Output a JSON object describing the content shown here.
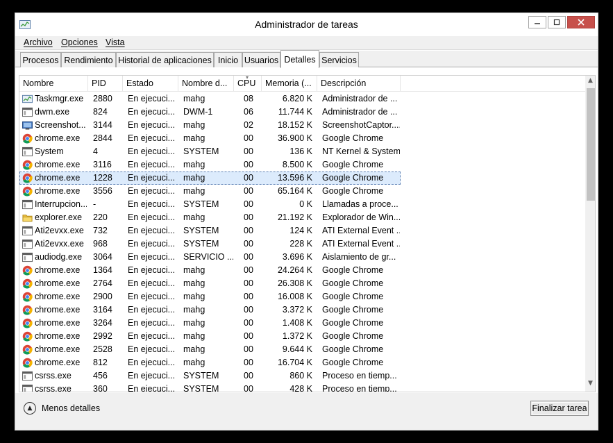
{
  "window": {
    "title": "Administrador de tareas"
  },
  "menu": [
    {
      "label": "Archivo",
      "name": "menu-archivo"
    },
    {
      "label": "Opciones",
      "name": "menu-opciones"
    },
    {
      "label": "Vista",
      "name": "menu-vista"
    }
  ],
  "tabs": [
    {
      "label": "Procesos",
      "name": "tab-procesos",
      "active": false
    },
    {
      "label": "Rendimiento",
      "name": "tab-rendimiento",
      "active": false
    },
    {
      "label": "Historial de aplicaciones",
      "name": "tab-historial",
      "active": false
    },
    {
      "label": "Inicio",
      "name": "tab-inicio",
      "active": false
    },
    {
      "label": "Usuarios",
      "name": "tab-usuarios",
      "active": false
    },
    {
      "label": "Detalles",
      "name": "tab-detalles",
      "active": true
    },
    {
      "label": "Servicios",
      "name": "tab-servicios",
      "active": false
    }
  ],
  "table": {
    "columns": [
      "Nombre",
      "PID",
      "Estado",
      "Nombre d...",
      "CPU",
      "Memoria (...",
      "Descripción"
    ],
    "rows": [
      {
        "icon": "taskmgr-icon",
        "name": "Taskmgr.exe",
        "pid": "2880",
        "estado": "En ejecuci...",
        "user": "mahg",
        "cpu": "08",
        "mem": "6.820 K",
        "desc": "Administrador de ..."
      },
      {
        "icon": "window-icon",
        "name": "dwm.exe",
        "pid": "824",
        "estado": "En ejecuci...",
        "user": "DWM-1",
        "cpu": "06",
        "mem": "11.744 K",
        "desc": "Administrador de ..."
      },
      {
        "icon": "screenshot-icon",
        "name": "Screenshot...",
        "pid": "3144",
        "estado": "En ejecuci...",
        "user": "mahg",
        "cpu": "02",
        "mem": "18.152 K",
        "desc": "ScreenshotCaptor...."
      },
      {
        "icon": "chrome-icon",
        "name": "chrome.exe",
        "pid": "2844",
        "estado": "En ejecuci...",
        "user": "mahg",
        "cpu": "00",
        "mem": "36.900 K",
        "desc": "Google Chrome"
      },
      {
        "icon": "window-icon",
        "name": "System",
        "pid": "4",
        "estado": "En ejecuci...",
        "user": "SYSTEM",
        "cpu": "00",
        "mem": "136 K",
        "desc": "NT Kernel & System"
      },
      {
        "icon": "chrome-icon",
        "name": "chrome.exe",
        "pid": "3116",
        "estado": "En ejecuci...",
        "user": "mahg",
        "cpu": "00",
        "mem": "8.500 K",
        "desc": "Google Chrome"
      },
      {
        "icon": "chrome-icon",
        "name": "chrome.exe",
        "pid": "1228",
        "estado": "En ejecuci...",
        "user": "mahg",
        "cpu": "00",
        "mem": "13.596 K",
        "desc": "Google Chrome",
        "selected": true
      },
      {
        "icon": "chrome-icon",
        "name": "chrome.exe",
        "pid": "3556",
        "estado": "En ejecuci...",
        "user": "mahg",
        "cpu": "00",
        "mem": "65.164 K",
        "desc": "Google Chrome"
      },
      {
        "icon": "window-icon",
        "name": "Interrupcion...",
        "pid": "-",
        "estado": "En ejecuci...",
        "user": "SYSTEM",
        "cpu": "00",
        "mem": "0 K",
        "desc": "Llamadas a proce..."
      },
      {
        "icon": "explorer-icon",
        "name": "explorer.exe",
        "pid": "220",
        "estado": "En ejecuci...",
        "user": "mahg",
        "cpu": "00",
        "mem": "21.192 K",
        "desc": "Explorador de Win..."
      },
      {
        "icon": "window-icon",
        "name": "Ati2evxx.exe",
        "pid": "732",
        "estado": "En ejecuci...",
        "user": "SYSTEM",
        "cpu": "00",
        "mem": "124 K",
        "desc": "ATI External Event ..."
      },
      {
        "icon": "window-icon",
        "name": "Ati2evxx.exe",
        "pid": "968",
        "estado": "En ejecuci...",
        "user": "SYSTEM",
        "cpu": "00",
        "mem": "228 K",
        "desc": "ATI External Event ..."
      },
      {
        "icon": "window-icon",
        "name": "audiodg.exe",
        "pid": "3064",
        "estado": "En ejecuci...",
        "user": "SERVICIO ...",
        "cpu": "00",
        "mem": "3.696 K",
        "desc": "Aislamiento de gr..."
      },
      {
        "icon": "chrome-icon",
        "name": "chrome.exe",
        "pid": "1364",
        "estado": "En ejecuci...",
        "user": "mahg",
        "cpu": "00",
        "mem": "24.264 K",
        "desc": "Google Chrome"
      },
      {
        "icon": "chrome-icon",
        "name": "chrome.exe",
        "pid": "2764",
        "estado": "En ejecuci...",
        "user": "mahg",
        "cpu": "00",
        "mem": "26.308 K",
        "desc": "Google Chrome"
      },
      {
        "icon": "chrome-icon",
        "name": "chrome.exe",
        "pid": "2900",
        "estado": "En ejecuci...",
        "user": "mahg",
        "cpu": "00",
        "mem": "16.008 K",
        "desc": "Google Chrome"
      },
      {
        "icon": "chrome-icon",
        "name": "chrome.exe",
        "pid": "3164",
        "estado": "En ejecuci...",
        "user": "mahg",
        "cpu": "00",
        "mem": "3.372 K",
        "desc": "Google Chrome"
      },
      {
        "icon": "chrome-icon",
        "name": "chrome.exe",
        "pid": "3264",
        "estado": "En ejecuci...",
        "user": "mahg",
        "cpu": "00",
        "mem": "1.408 K",
        "desc": "Google Chrome"
      },
      {
        "icon": "chrome-icon",
        "name": "chrome.exe",
        "pid": "2992",
        "estado": "En ejecuci...",
        "user": "mahg",
        "cpu": "00",
        "mem": "1.372 K",
        "desc": "Google Chrome"
      },
      {
        "icon": "chrome-icon",
        "name": "chrome.exe",
        "pid": "2528",
        "estado": "En ejecuci...",
        "user": "mahg",
        "cpu": "00",
        "mem": "9.644 K",
        "desc": "Google Chrome"
      },
      {
        "icon": "chrome-icon",
        "name": "chrome.exe",
        "pid": "812",
        "estado": "En ejecuci...",
        "user": "mahg",
        "cpu": "00",
        "mem": "16.704 K",
        "desc": "Google Chrome"
      },
      {
        "icon": "window-icon",
        "name": "csrss.exe",
        "pid": "456",
        "estado": "En ejecuci...",
        "user": "SYSTEM",
        "cpu": "00",
        "mem": "860 K",
        "desc": "Proceso en tiemp..."
      },
      {
        "icon": "window-icon",
        "name": "csrss.exe",
        "pid": "360",
        "estado": "En ejecuci...",
        "user": "SYSTEM",
        "cpu": "00",
        "mem": "428 K",
        "desc": "Proceso en tiemp..."
      }
    ]
  },
  "footer": {
    "fewer_details": "Menos detalles",
    "end_task": "Finalizar tarea"
  },
  "colors": {
    "selection": "#dcebfc",
    "close_button": "#c7504b",
    "chrome_red": "#db4437",
    "chrome_yellow": "#f4b400",
    "chrome_green": "#0f9d58",
    "chrome_blue": "#4285f4"
  }
}
